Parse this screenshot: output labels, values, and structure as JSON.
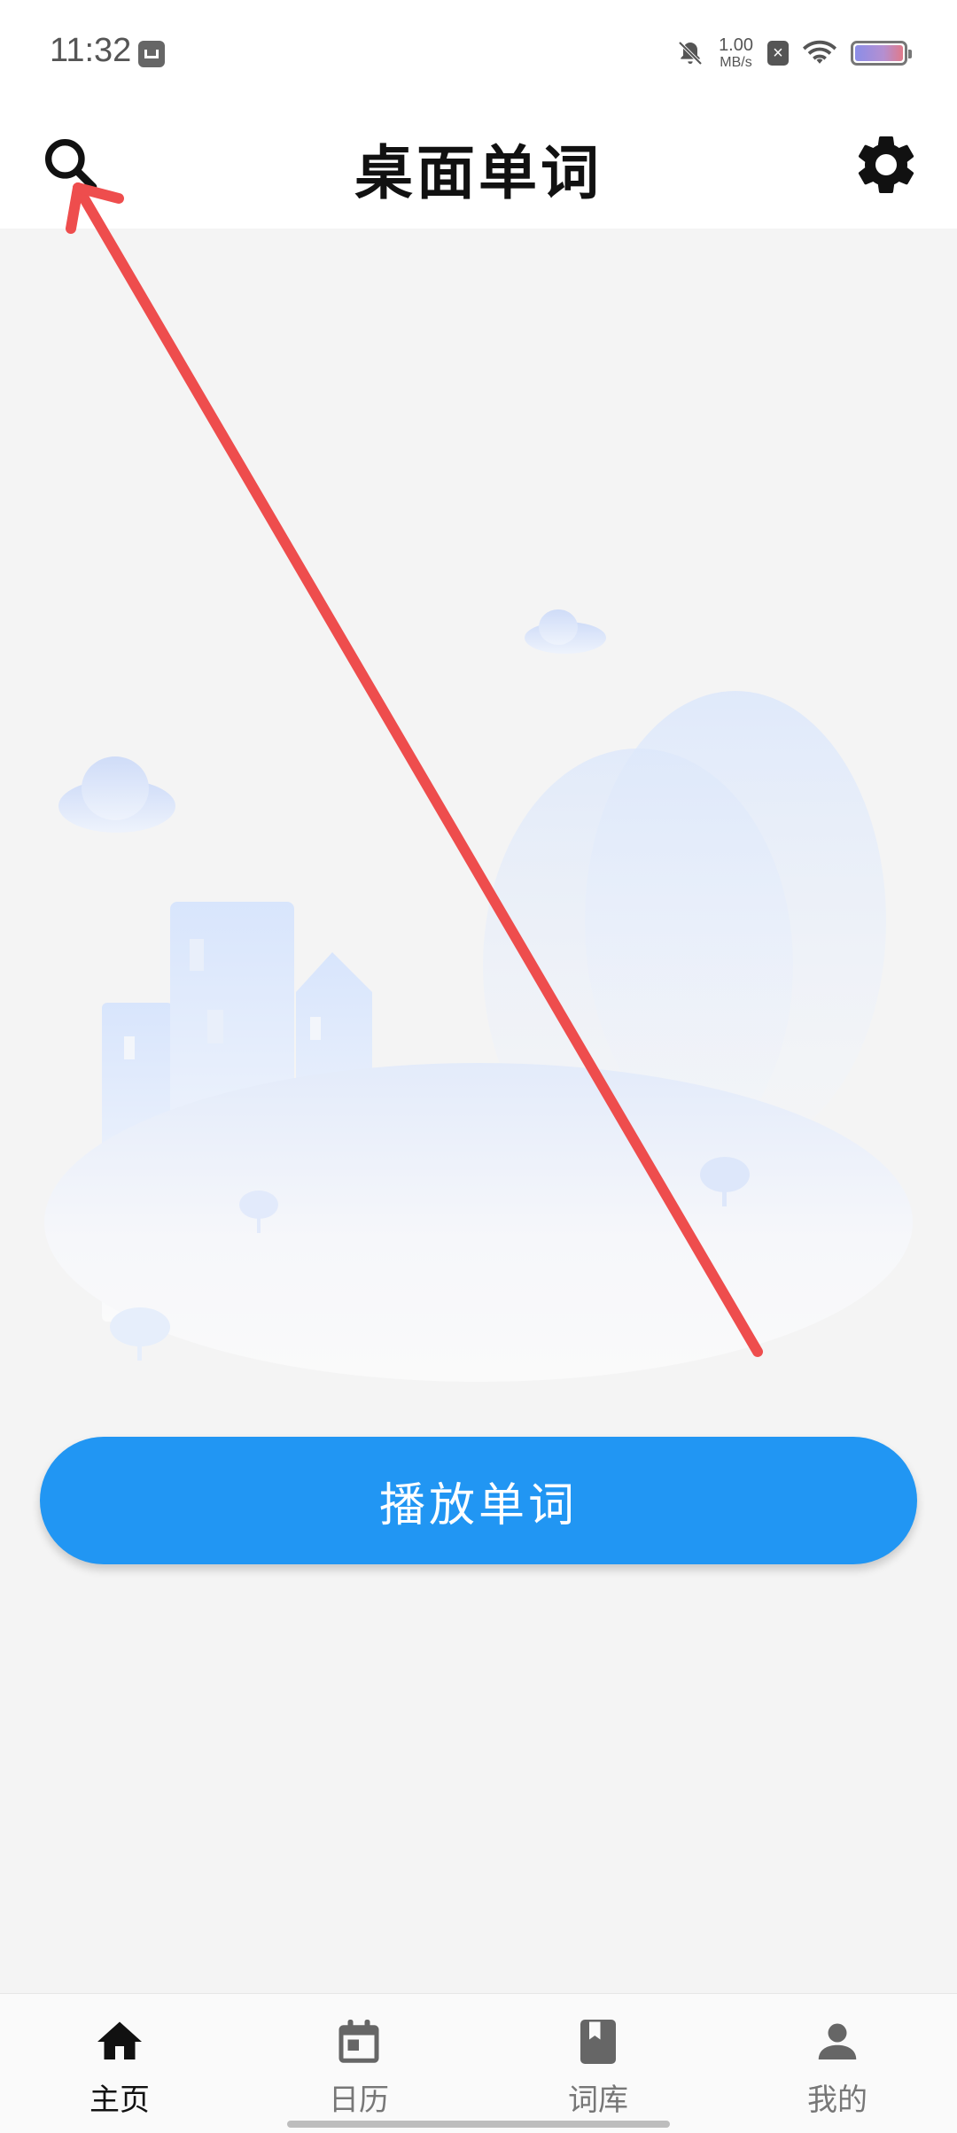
{
  "status_bar": {
    "time": "11:32",
    "net_speed_value": "1.00",
    "net_speed_unit": "MB/s",
    "sim_badge": "×",
    "icons": [
      "app-notification-icon",
      "mute-icon",
      "sim-off-icon",
      "wifi-icon",
      "battery-icon"
    ]
  },
  "app_bar": {
    "title": "桌面单词",
    "left_icon": "search-icon",
    "right_icon": "gear-icon"
  },
  "main": {
    "play_button_label": "播放单词",
    "illustration": "city-clouds-illustration"
  },
  "bottom_nav": {
    "items": [
      {
        "label": "主页",
        "icon": "home-icon",
        "active": true
      },
      {
        "label": "日历",
        "icon": "calendar-icon",
        "active": false
      },
      {
        "label": "词库",
        "icon": "book-icon",
        "active": false
      },
      {
        "label": "我的",
        "icon": "person-icon",
        "active": false
      }
    ]
  },
  "colors": {
    "accent": "#2196f3",
    "annotation_arrow": "#ee4d4d",
    "background": "#f4f4f4"
  }
}
